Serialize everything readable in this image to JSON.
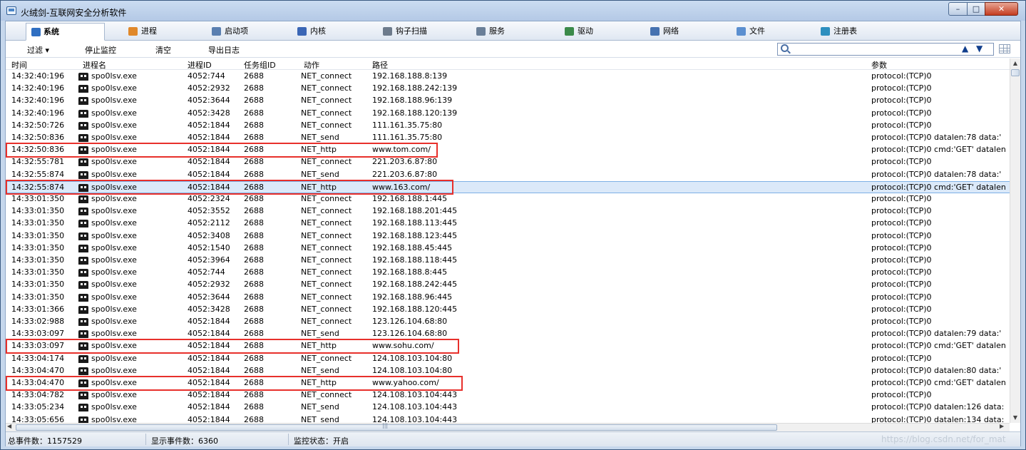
{
  "window": {
    "title": "火绒剑-互联网安全分析软件",
    "controls": {
      "minimize": "–",
      "maximize": "□",
      "close": "✕"
    }
  },
  "tabs": [
    {
      "label": "系统",
      "icon": "system-monitor-icon",
      "color": "#2f6fc2",
      "active": true
    },
    {
      "label": "进程",
      "icon": "process-icon",
      "color": "#e0882a"
    },
    {
      "label": "启动项",
      "icon": "startup-icon",
      "color": "#5a7fb0"
    },
    {
      "label": "内核",
      "icon": "kernel-icon",
      "color": "#3a66b5"
    },
    {
      "label": "钩子扫描",
      "icon": "hook-scan-icon",
      "color": "#6d7b8c"
    },
    {
      "label": "服务",
      "icon": "service-icon",
      "color": "#6a7f98"
    },
    {
      "label": "驱动",
      "icon": "driver-icon",
      "color": "#3b8a4a"
    },
    {
      "label": "网络",
      "icon": "network-icon",
      "color": "#4672b0"
    },
    {
      "label": "文件",
      "icon": "file-icon",
      "color": "#5b8fd0"
    },
    {
      "label": "注册表",
      "icon": "registry-icon",
      "color": "#2d8fbf"
    }
  ],
  "toolbar": {
    "filter": "过滤 ▾",
    "stop_monitor": "停止监控",
    "clear": "清空",
    "export_log": "导出日志",
    "search_value": "",
    "nav_up": "▲",
    "nav_down": "▼"
  },
  "table": {
    "columns": [
      "时间",
      "进程名",
      "进程ID",
      "任务组ID",
      "动作",
      "路径",
      "参数"
    ],
    "rows": [
      [
        "14:32:40:196",
        "spo0lsv.exe",
        "4052:744",
        "2688",
        "NET_connect",
        "192.168.188.8:139",
        "protocol:(TCP)0"
      ],
      [
        "14:32:40:196",
        "spo0lsv.exe",
        "4052:2932",
        "2688",
        "NET_connect",
        "192.168.188.242:139",
        "protocol:(TCP)0"
      ],
      [
        "14:32:40:196",
        "spo0lsv.exe",
        "4052:3644",
        "2688",
        "NET_connect",
        "192.168.188.96:139",
        "protocol:(TCP)0"
      ],
      [
        "14:32:40:196",
        "spo0lsv.exe",
        "4052:3428",
        "2688",
        "NET_connect",
        "192.168.188.120:139",
        "protocol:(TCP)0"
      ],
      [
        "14:32:50:726",
        "spo0lsv.exe",
        "4052:1844",
        "2688",
        "NET_connect",
        "111.161.35.75:80",
        "protocol:(TCP)0"
      ],
      [
        "14:32:50:836",
        "spo0lsv.exe",
        "4052:1844",
        "2688",
        "NET_send",
        "111.161.35.75:80",
        "protocol:(TCP)0 datalen:78 data:'"
      ],
      [
        "14:32:50:836",
        "spo0lsv.exe",
        "4052:1844",
        "2688",
        "NET_http",
        "www.tom.com/",
        "protocol:(TCP)0 cmd:'GET' datalen"
      ],
      [
        "14:32:55:781",
        "spo0lsv.exe",
        "4052:1844",
        "2688",
        "NET_connect",
        "221.203.6.87:80",
        "protocol:(TCP)0"
      ],
      [
        "14:32:55:874",
        "spo0lsv.exe",
        "4052:1844",
        "2688",
        "NET_send",
        "221.203.6.87:80",
        "protocol:(TCP)0 datalen:78 data:'"
      ],
      [
        "14:32:55:874",
        "spo0lsv.exe",
        "4052:1844",
        "2688",
        "NET_http",
        "www.163.com/",
        "protocol:(TCP)0 cmd:'GET' datalen"
      ],
      [
        "14:33:01:350",
        "spo0lsv.exe",
        "4052:2324",
        "2688",
        "NET_connect",
        "192.168.188.1:445",
        "protocol:(TCP)0"
      ],
      [
        "14:33:01:350",
        "spo0lsv.exe",
        "4052:3552",
        "2688",
        "NET_connect",
        "192.168.188.201:445",
        "protocol:(TCP)0"
      ],
      [
        "14:33:01:350",
        "spo0lsv.exe",
        "4052:2112",
        "2688",
        "NET_connect",
        "192.168.188.113:445",
        "protocol:(TCP)0"
      ],
      [
        "14:33:01:350",
        "spo0lsv.exe",
        "4052:3408",
        "2688",
        "NET_connect",
        "192.168.188.123:445",
        "protocol:(TCP)0"
      ],
      [
        "14:33:01:350",
        "spo0lsv.exe",
        "4052:1540",
        "2688",
        "NET_connect",
        "192.168.188.45:445",
        "protocol:(TCP)0"
      ],
      [
        "14:33:01:350",
        "spo0lsv.exe",
        "4052:3964",
        "2688",
        "NET_connect",
        "192.168.188.118:445",
        "protocol:(TCP)0"
      ],
      [
        "14:33:01:350",
        "spo0lsv.exe",
        "4052:744",
        "2688",
        "NET_connect",
        "192.168.188.8:445",
        "protocol:(TCP)0"
      ],
      [
        "14:33:01:350",
        "spo0lsv.exe",
        "4052:2932",
        "2688",
        "NET_connect",
        "192.168.188.242:445",
        "protocol:(TCP)0"
      ],
      [
        "14:33:01:350",
        "spo0lsv.exe",
        "4052:3644",
        "2688",
        "NET_connect",
        "192.168.188.96:445",
        "protocol:(TCP)0"
      ],
      [
        "14:33:01:366",
        "spo0lsv.exe",
        "4052:3428",
        "2688",
        "NET_connect",
        "192.168.188.120:445",
        "protocol:(TCP)0"
      ],
      [
        "14:33:02:988",
        "spo0lsv.exe",
        "4052:1844",
        "2688",
        "NET_connect",
        "123.126.104.68:80",
        "protocol:(TCP)0"
      ],
      [
        "14:33:03:097",
        "spo0lsv.exe",
        "4052:1844",
        "2688",
        "NET_send",
        "123.126.104.68:80",
        "protocol:(TCP)0 datalen:79 data:'"
      ],
      [
        "14:33:03:097",
        "spo0lsv.exe",
        "4052:1844",
        "2688",
        "NET_http",
        "www.sohu.com/",
        "protocol:(TCP)0 cmd:'GET' datalen"
      ],
      [
        "14:33:04:174",
        "spo0lsv.exe",
        "4052:1844",
        "2688",
        "NET_connect",
        "124.108.103.104:80",
        "protocol:(TCP)0"
      ],
      [
        "14:33:04:470",
        "spo0lsv.exe",
        "4052:1844",
        "2688",
        "NET_send",
        "124.108.103.104:80",
        "protocol:(TCP)0 datalen:80 data:'"
      ],
      [
        "14:33:04:470",
        "spo0lsv.exe",
        "4052:1844",
        "2688",
        "NET_http",
        "www.yahoo.com/",
        "protocol:(TCP)0 cmd:'GET' datalen"
      ],
      [
        "14:33:04:782",
        "spo0lsv.exe",
        "4052:1844",
        "2688",
        "NET_connect",
        "124.108.103.104:443",
        "protocol:(TCP)0"
      ],
      [
        "14:33:05:234",
        "spo0lsv.exe",
        "4052:1844",
        "2688",
        "NET_send",
        "124.108.103.104:443",
        "protocol:(TCP)0 datalen:126 data:"
      ],
      [
        "14:33:05:656",
        "spo0lsv.exe",
        "4052:1844",
        "2688",
        "NET_send",
        "124.108.103.104:443",
        "protocol:(TCP)0 datalen:134 data:"
      ]
    ],
    "selected_row": 9,
    "highlighted_rows": [
      6,
      9,
      22,
      25
    ],
    "highlight_color": "#e8302b"
  },
  "status": {
    "total_events": "总事件数：1157529",
    "shown_events": "显示事件数：6360",
    "monitor_state": "监控状态：开启"
  },
  "watermark": "https://blog.csdn.net/for_mat"
}
